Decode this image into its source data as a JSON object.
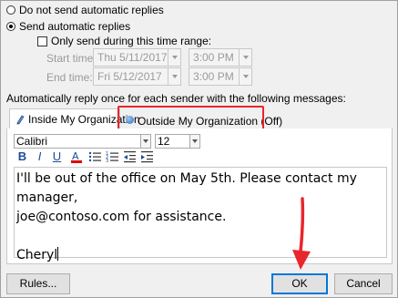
{
  "options": {
    "do_not_send": "Do not send automatic replies",
    "send": "Send automatic replies",
    "time_range": "Only send during this time range:"
  },
  "time": {
    "start_label": "Start time:",
    "start_date": "Thu 5/11/2017",
    "start_time": "3:00 PM",
    "end_label": "End time:",
    "end_date": "Fri 5/12/2017",
    "end_time": "3:00 PM"
  },
  "auto_reply_label": "Automatically reply once for each sender with the following messages:",
  "tabs": {
    "inside": "Inside My Organization",
    "outside": "Outside My Organization (Off)"
  },
  "toolbar": {
    "font": "Calibri",
    "size": "12",
    "bold": "B",
    "italic": "I",
    "underline": "U"
  },
  "message": {
    "line1": "I'll be out of the office on May 5th. Please contact my manager,",
    "line2": "joe@contoso.com for assistance.",
    "line3": "Cheryl"
  },
  "buttons": {
    "rules": "Rules...",
    "ok": "OK",
    "cancel": "Cancel"
  },
  "colors": {
    "highlight": "#e8262c",
    "arrow": "#e8262c",
    "accent": "#0078d7"
  }
}
